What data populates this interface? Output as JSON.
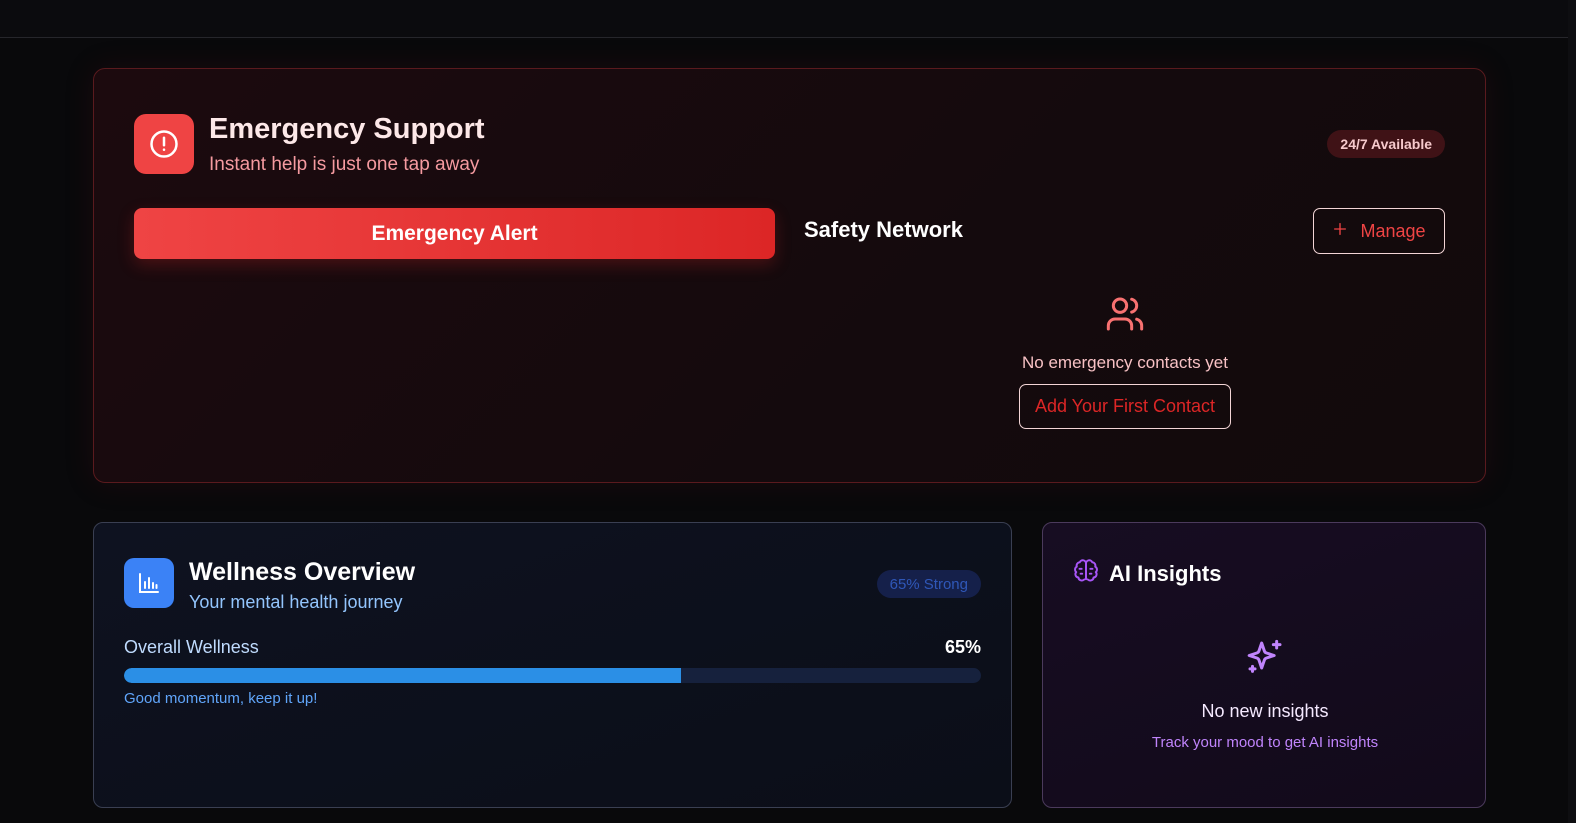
{
  "emergency": {
    "title": "Emergency Support",
    "subtitle": "Instant help is just one tap away",
    "availability_badge": "24/7 Available",
    "alert_button": "Emergency Alert",
    "safety_network_title": "Safety Network",
    "manage_button": "Manage",
    "empty_contacts_text": "No emergency contacts yet",
    "add_contact_button": "Add Your First Contact",
    "accent_color": "#ef4444",
    "icons": {
      "header": "alert-circle-icon",
      "manage": "plus-icon",
      "empty": "users-icon"
    }
  },
  "wellness": {
    "title": "Wellness Overview",
    "subtitle": "Your mental health journey",
    "status_badge": "65% Strong",
    "metric_label": "Overall Wellness",
    "metric_value": "65%",
    "progress": 0.65,
    "note": "Good momentum, keep it up!",
    "accent_color": "#3b82f6",
    "icons": {
      "header": "bar-chart-icon"
    }
  },
  "ai_insights": {
    "title": "AI Insights",
    "empty_title": "No new insights",
    "empty_subtitle": "Track your mood to get AI insights",
    "accent_color": "#a855f7",
    "icons": {
      "header": "brain-icon",
      "empty": "sparkles-icon"
    }
  }
}
